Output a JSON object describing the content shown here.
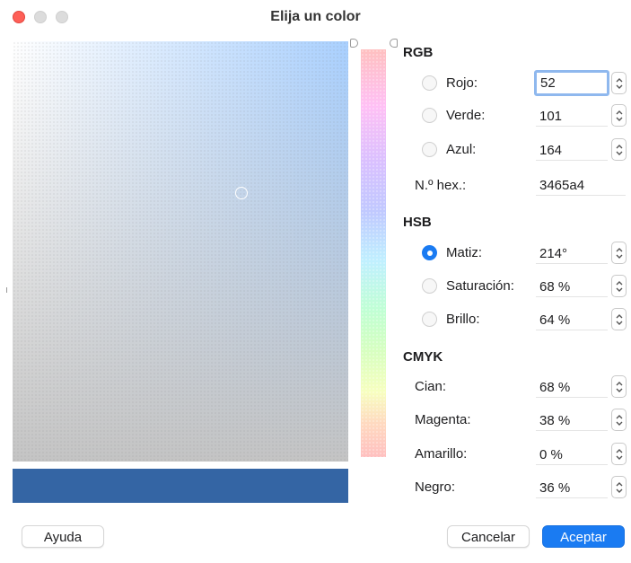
{
  "window": {
    "title": "Elija un color"
  },
  "colors": {
    "current": "#3465a4",
    "accent": "#1a7bf2",
    "close": "#fe5f57"
  },
  "rgb": {
    "title": "RGB",
    "red": {
      "label": "Rojo:",
      "value": "52"
    },
    "green": {
      "label": "Verde:",
      "value": "101"
    },
    "blue": {
      "label": "Azul:",
      "value": "164"
    },
    "hex": {
      "label": "N.º hex.:",
      "value": "3465a4"
    }
  },
  "hsb": {
    "title": "HSB",
    "hue": {
      "label": "Matiz:",
      "value": "214°",
      "selected": true
    },
    "saturation": {
      "label": "Saturación:",
      "value": "68 %"
    },
    "brightness": {
      "label": "Brillo:",
      "value": "64 %"
    }
  },
  "cmyk": {
    "title": "CMYK",
    "cyan": {
      "label": "Cian:",
      "value": "68 %"
    },
    "magenta": {
      "label": "Magenta:",
      "value": "38 %"
    },
    "yellow": {
      "label": "Amarillo:",
      "value": "0 %"
    },
    "black": {
      "label": "Negro:",
      "value": "36 %"
    }
  },
  "buttons": {
    "help": "Ayuda",
    "cancel": "Cancelar",
    "accept": "Aceptar"
  },
  "icons": {
    "stepper": "up-down-chevron-icon",
    "picker": "color-picker-ring"
  }
}
